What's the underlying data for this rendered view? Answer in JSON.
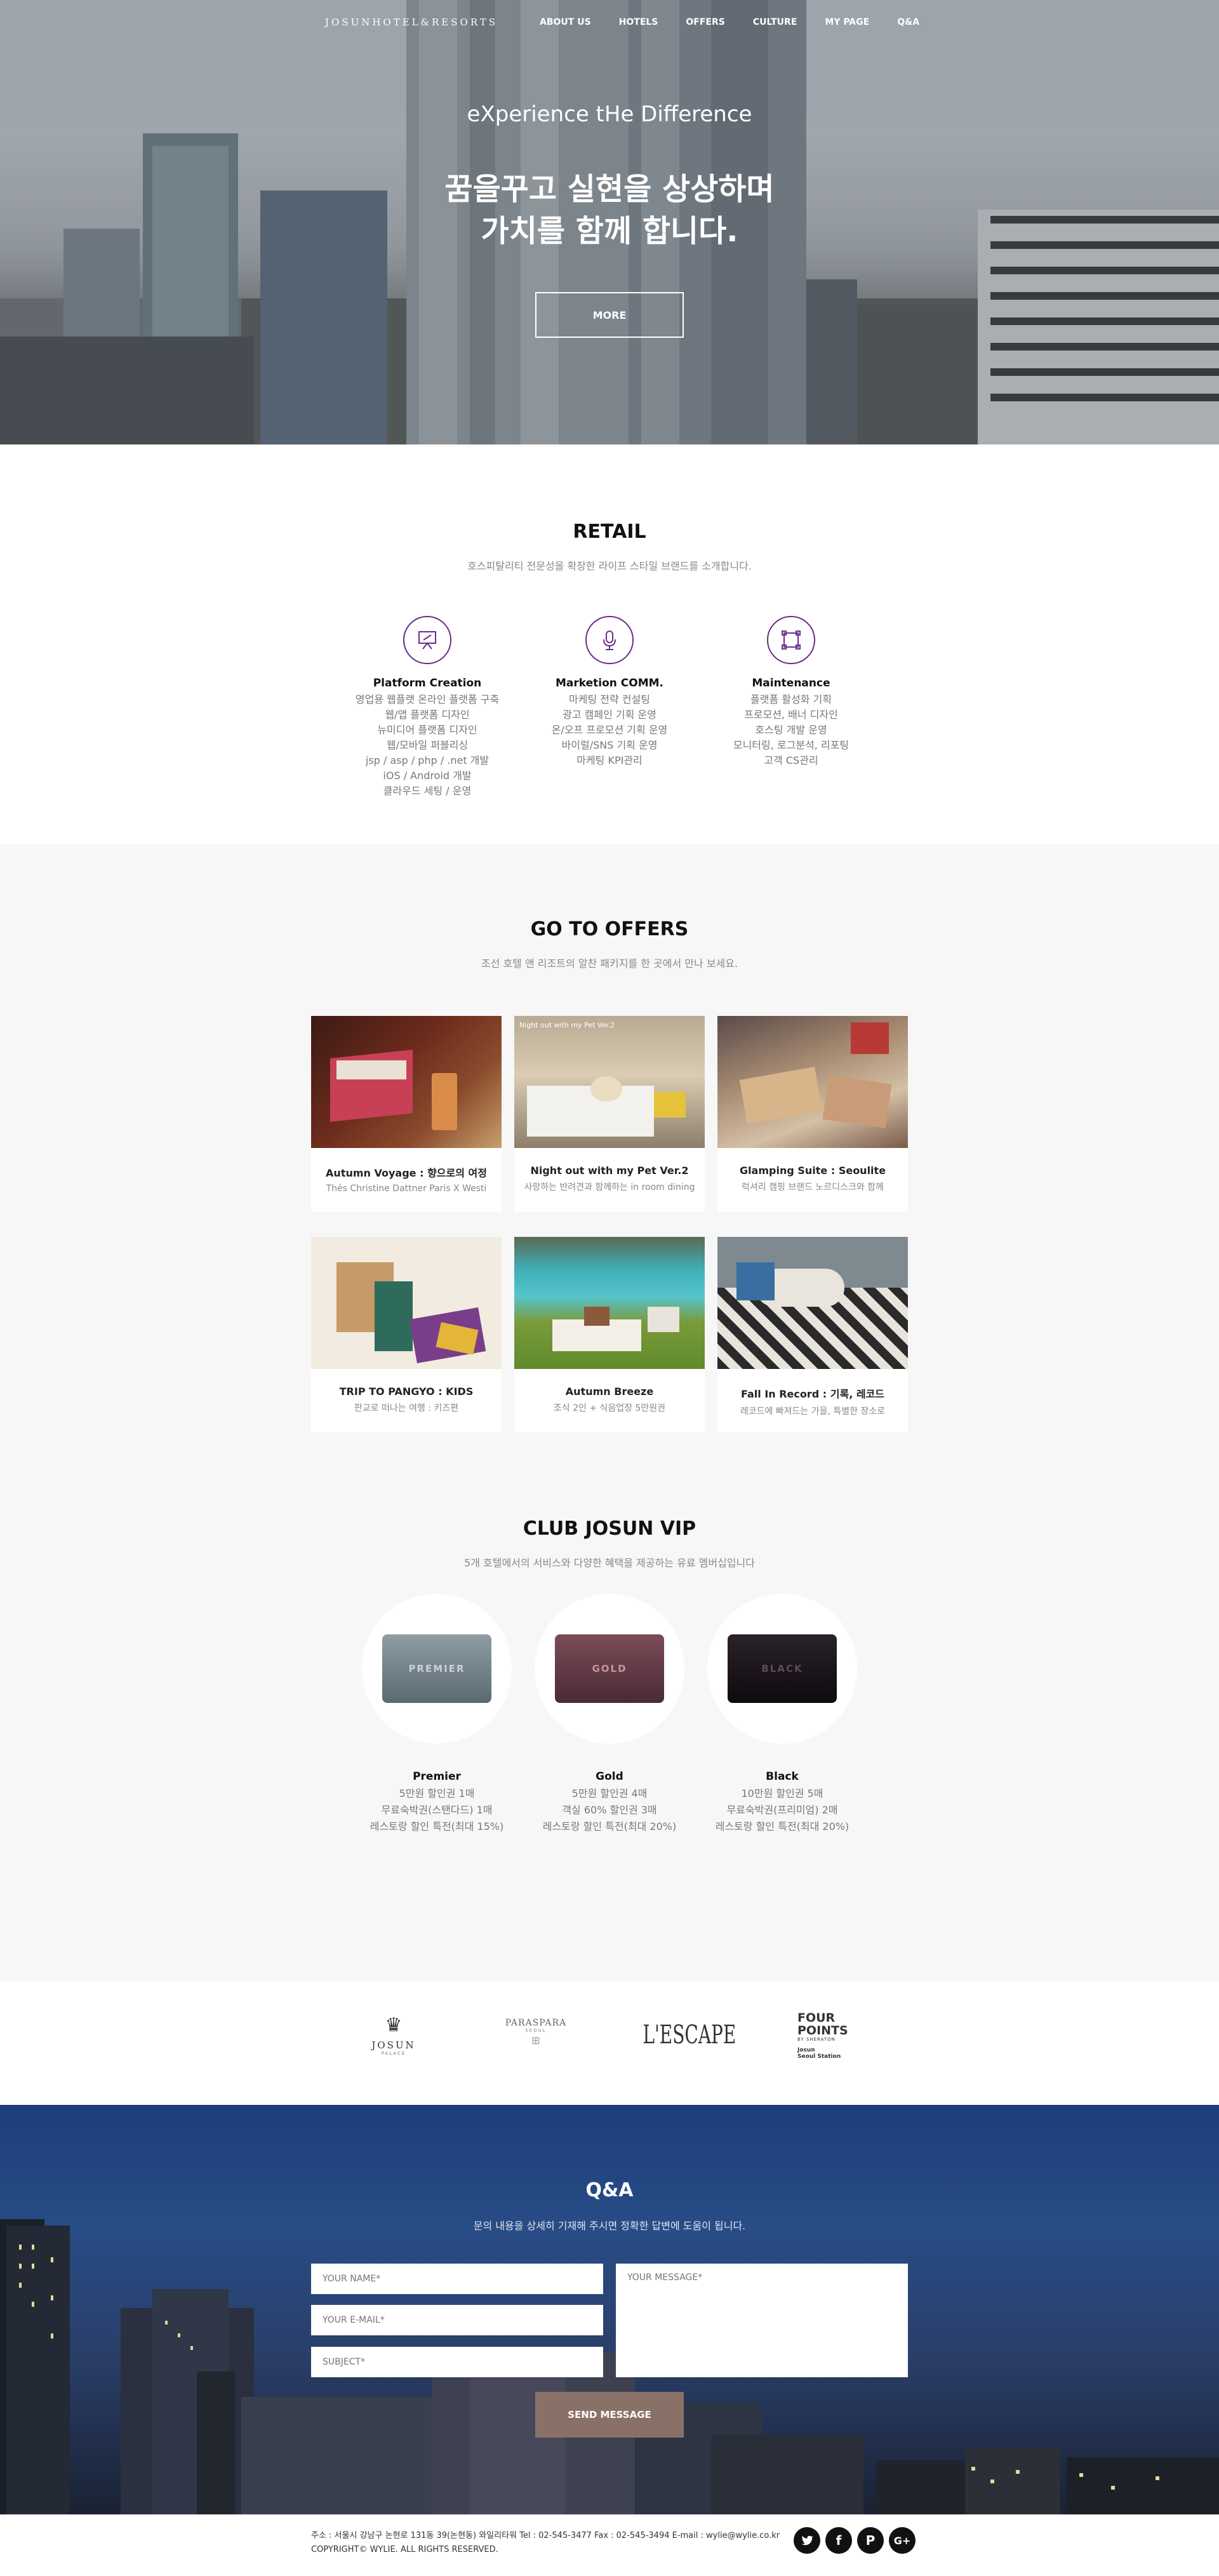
{
  "nav": {
    "logo": "JOSUNHOTEL&RESORTS",
    "links": [
      "ABOUT US",
      "HOTELS",
      "OFFERS",
      "CULTURE",
      "MY PAGE",
      "Q&A"
    ]
  },
  "hero": {
    "subtitle": "eXperience tHe Difference",
    "title_line1": "꿈을꾸고 실현을 상상하며",
    "title_line2": "가치를 함께 합니다.",
    "button": "MORE"
  },
  "retail": {
    "title": "RETAIL",
    "desc": "호스피탈리티 전문성을 확장한 라이프 스타일 브랜드를 소개합니다.",
    "services": [
      {
        "icon": "presentation-icon",
        "title": "Platform Creation",
        "items": [
          "영업용 웹플랫 온라인 플랫폼 구축",
          "웹/앱 플랫폼 디자인",
          "뉴미디어 플랫폼 디자인",
          "웹/모바일 퍼블리싱",
          "jsp / asp / php / .net 개발",
          "iOS / Android 개발",
          "클라우드 세팅 / 운영"
        ]
      },
      {
        "icon": "microphone-icon",
        "title": "Marketion COMM.",
        "items": [
          "마케팅 전략 컨설팅",
          "광고 캠페인 기획 운영",
          "온/오프 프로모션 기획 운영",
          "바이럴/SNS 기획 운영",
          "마케팅 KPI관리"
        ]
      },
      {
        "icon": "frame-icon",
        "title": "Maintenance",
        "items": [
          "플랫폼 활성화 기획",
          "프로모션, 배너 디자인",
          "호스팅 개발 운영",
          "모니터링, 로그분석, 리포팅",
          "고객 CS관리"
        ]
      }
    ]
  },
  "offers": {
    "title": "GO TO OFFERS",
    "desc": "조선 호텔 앤 리조트의 알찬 패키지를 한 곳에서 만나 보세요.",
    "cards": [
      {
        "title": "Autumn Voyage : 향으로의 여정",
        "sub": "Thés Christine Dattner Paris X Westi"
      },
      {
        "title": "Night out with my Pet Ver.2",
        "sub": "사랑하는 반려견과 함께하는 in room dining",
        "caption": "Night out with my Pet Ver.2"
      },
      {
        "title": "Glamping Suite : Seoulite",
        "sub": "럭셔리 캠핑 브랜드 노르디스크와 함께"
      },
      {
        "title": "TRIP TO PANGYO : KIDS",
        "sub": "판교로 떠나는 여행 : 키즈편"
      },
      {
        "title": "Autumn Breeze",
        "sub": "조식 2인 + 식음업장 5만원권"
      },
      {
        "title": "Fall In Record : 기록, 레코드",
        "sub": "레코드에 빠져드는 가을, 특별한 장소로"
      }
    ]
  },
  "vip": {
    "title": "CLUB JOSUN VIP",
    "desc": "5개 호텔에서의 서비스와 다양한 혜택을 제공하는 유료 멤버십입니다",
    "tiers": [
      {
        "card": "PREMIER",
        "name": "Premier",
        "items": [
          "5만원 할인권 1매",
          "무료숙박권(스탠다드) 1매",
          "레스토랑 할인 특전(최대 15%)"
        ]
      },
      {
        "card": "GOLD",
        "name": "Gold",
        "items": [
          "5만원 할인권 4매",
          "객실 60% 할인권 3매",
          "레스토랑 할인 특전(최대 20%)"
        ]
      },
      {
        "card": "BLACK",
        "name": "Black",
        "items": [
          "10만원 할인권 5매",
          "무료숙박권(프리미엄) 2매",
          "레스토랑 할인 특전(최대 20%)"
        ]
      }
    ]
  },
  "brands": {
    "josun": "JOSUN",
    "josun_sub": "PALACE",
    "paraspara": "PARASPARA",
    "paraspara_sub": "SEOUL",
    "lescape": "L'ESCAPE",
    "fourpoints_line1": "FOUR",
    "fourpoints_line2": "POINTS",
    "fourpoints_sub": "BY SHERATON",
    "fourpoints_loc1": "Josun",
    "fourpoints_loc2": "Seoul Station"
  },
  "qa": {
    "title": "Q&A",
    "desc": "문의 내용을 상세히 기재해 주시면 정확한 답변에 도움이 됩니다.",
    "name_placeholder": "YOUR NAME*",
    "email_placeholder": "YOUR E-MAIL*",
    "subject_placeholder": "SUBJECT*",
    "message_placeholder": "YOUR MESSAGE*",
    "send": "SEND MESSAGE"
  },
  "footer": {
    "address": "주소 : 서울시 강남구 논현로 131동 39(논현동) 와일리타워 Tel : 02-545-3477 Fax : 02-545-3494 E-mail : wylie@wylie.co.kr",
    "copyright": "COPYRIGHT© WYLIE. ALL RIGHTS RESERVED."
  }
}
